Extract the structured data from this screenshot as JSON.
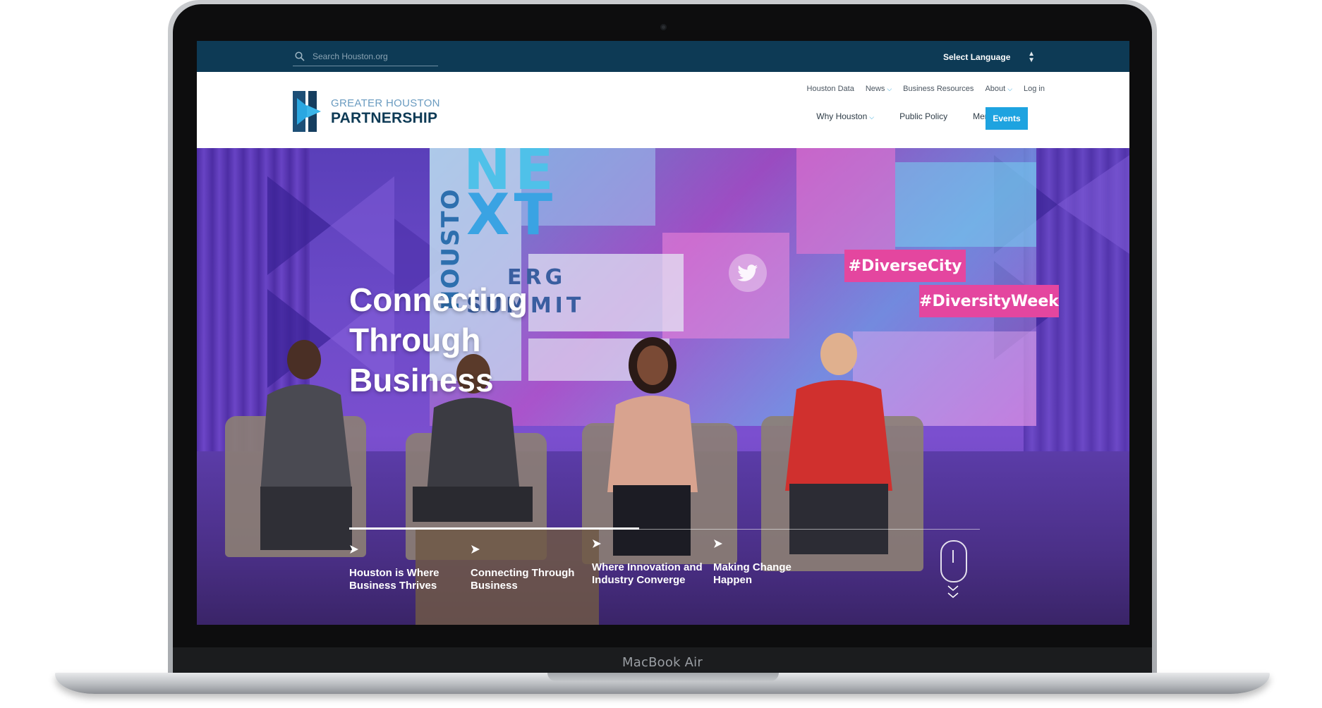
{
  "device": {
    "label": "MacBook Air"
  },
  "topbar": {
    "search_placeholder": "Search Houston.org",
    "language_select": "Select Language"
  },
  "header": {
    "logo": {
      "line1": "GREATER HOUSTON",
      "line2": "PARTNERSHIP"
    },
    "util_nav": [
      "Houston Data",
      "News",
      "Business Resources",
      "About",
      "Log in"
    ],
    "main_nav": [
      "Why Houston",
      "Public Policy",
      "Membership"
    ],
    "events_button": "Events"
  },
  "hero": {
    "title_lines": [
      "Connecting",
      "Through",
      "Business"
    ],
    "backdrop": {
      "vertical": "HOUSTO",
      "big1": "NE",
      "big2": "XT",
      "line1": "ERG",
      "line2": "SUMMIT",
      "hashtag1": "#DiverseCity",
      "hashtag2": "#DiversityWeek"
    },
    "slides": [
      {
        "line1": "Houston is Where",
        "line2": "Business Thrives"
      },
      {
        "line1": "Connecting Through",
        "line2": "Business"
      },
      {
        "line1": "Where Innovation and",
        "line2": "Industry Converge"
      },
      {
        "line1": "Making Change",
        "line2": "Happen"
      }
    ],
    "slider_progress": 0.46
  },
  "colors": {
    "topbar": "#0d3a55",
    "accent": "#1ea3e0",
    "hashtag": "#e4469f"
  }
}
